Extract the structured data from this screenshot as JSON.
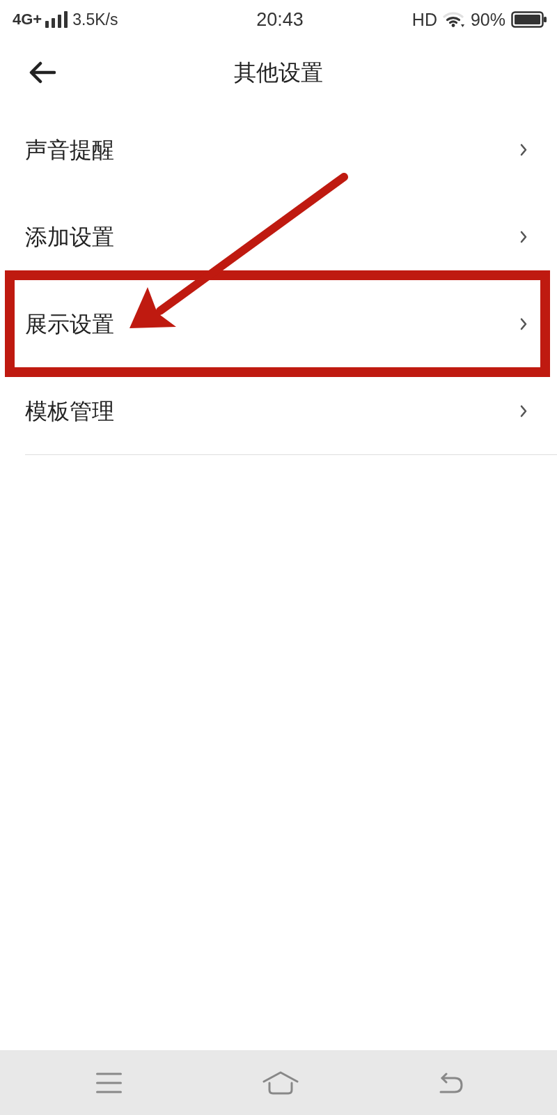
{
  "status_bar": {
    "network": "4G+",
    "speed": "3.5K/s",
    "time": "20:43",
    "hd": "HD",
    "battery": "90%"
  },
  "header": {
    "title": "其他设置"
  },
  "rows": [
    {
      "label": "声音提醒",
      "highlighted": false
    },
    {
      "label": "添加设置",
      "highlighted": false
    },
    {
      "label": "展示设置",
      "highlighted": true
    },
    {
      "label": "模板管理",
      "highlighted": false
    }
  ]
}
